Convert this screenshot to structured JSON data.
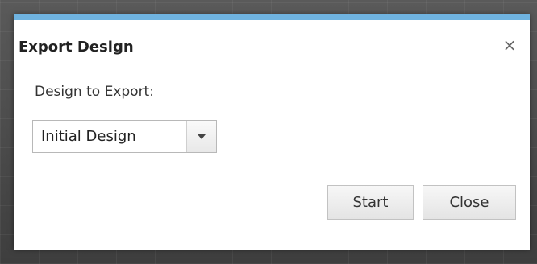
{
  "dialog": {
    "title": "Export Design",
    "close_glyph": "×",
    "accent_color": "#6fb3e0"
  },
  "form": {
    "design_label": "Design to Export:",
    "design_select": {
      "selected": "Initial Design"
    }
  },
  "buttons": {
    "start_label": "Start",
    "close_label": "Close"
  }
}
